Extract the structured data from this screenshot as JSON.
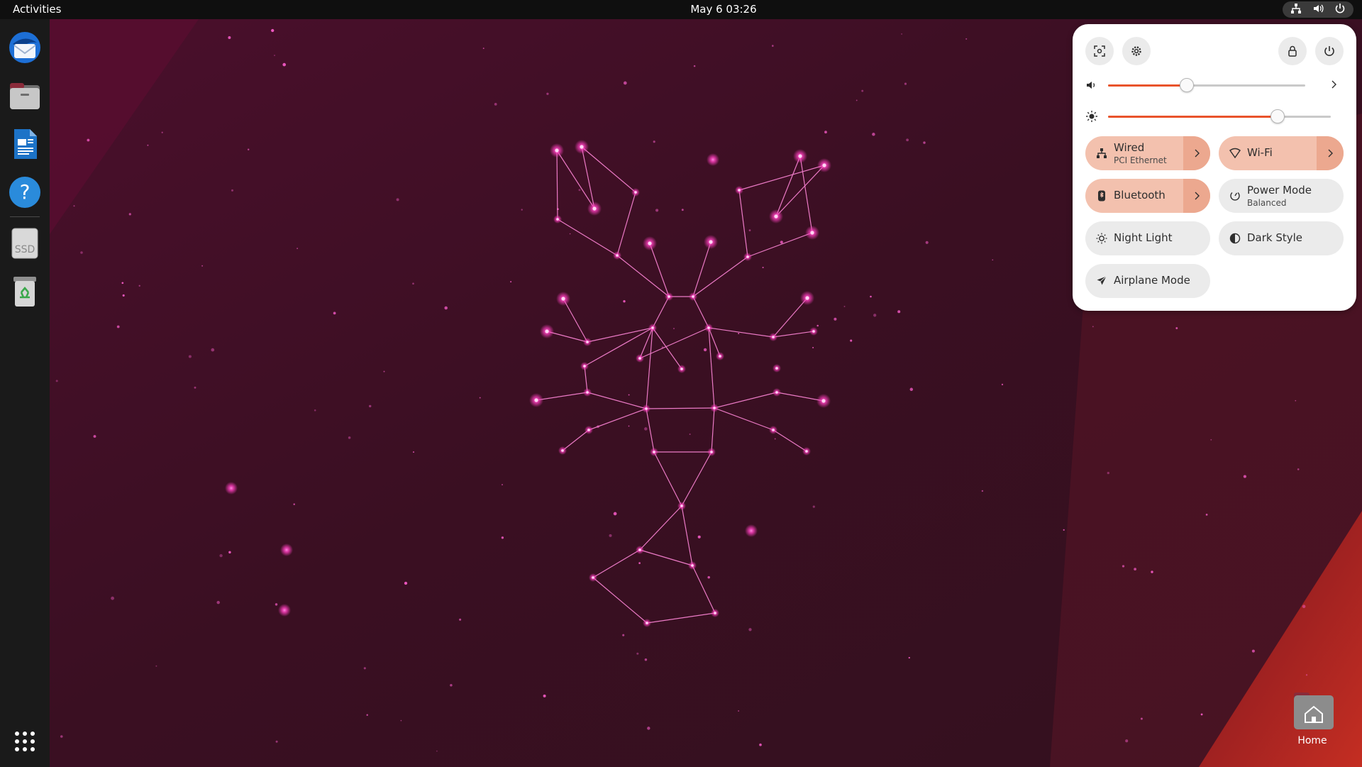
{
  "topbar": {
    "activities_label": "Activities",
    "clock": "May 6  03:26",
    "tray_icons": [
      "network-wired-icon",
      "volume-icon",
      "power-icon"
    ]
  },
  "dock": {
    "items": [
      {
        "name": "thunderbird",
        "icon": "thunderbird-icon"
      },
      {
        "name": "files",
        "icon": "files-folder-icon"
      },
      {
        "name": "libreoffice-writer",
        "icon": "writer-document-icon"
      },
      {
        "name": "help",
        "icon": "help-icon",
        "glyph": "?"
      },
      {
        "name": "ssd-drive",
        "icon": "ssd-drive-icon",
        "label": "SSD"
      },
      {
        "name": "trash",
        "icon": "trash-icon"
      }
    ],
    "apps_grid_icon": "show-apps-grid-icon"
  },
  "desktop": {
    "home_label": "Home"
  },
  "quick_settings": {
    "top_buttons": {
      "left": [
        "screenshot-icon",
        "settings-gear-icon"
      ],
      "right": [
        "lock-icon",
        "power-off-icon"
      ]
    },
    "volume": {
      "icon": "speaker-icon",
      "level": 0.4
    },
    "brightness": {
      "icon": "brightness-icon",
      "level": 0.76
    },
    "tiles": [
      {
        "id": "wired",
        "title": "Wired",
        "subtitle": "PCI Ethernet",
        "active": true,
        "has_menu": true,
        "icon": "network-wired-icon"
      },
      {
        "id": "wifi",
        "title": "Wi-Fi",
        "subtitle": "",
        "active": true,
        "has_menu": true,
        "icon": "wifi-icon"
      },
      {
        "id": "bluetooth",
        "title": "Bluetooth",
        "subtitle": "",
        "active": true,
        "has_menu": true,
        "icon": "bluetooth-icon"
      },
      {
        "id": "power-mode",
        "title": "Power Mode",
        "subtitle": "Balanced",
        "active": false,
        "has_menu": false,
        "icon": "power-mode-icon"
      },
      {
        "id": "night-light",
        "title": "Night Light",
        "subtitle": "",
        "active": false,
        "has_menu": false,
        "icon": "night-light-icon"
      },
      {
        "id": "dark-style",
        "title": "Dark Style",
        "subtitle": "",
        "active": false,
        "has_menu": false,
        "icon": "dark-style-icon"
      },
      {
        "id": "airplane-mode",
        "title": "Airplane Mode",
        "subtitle": "",
        "active": false,
        "has_menu": false,
        "icon": "airplane-icon"
      }
    ]
  },
  "colors": {
    "accent": "#e9532b",
    "tile_active": "#f3c1ae",
    "tile_inactive": "#ebebeb",
    "wallpaper_base": "#3a0f22",
    "constellation": "#ff4fc8"
  }
}
